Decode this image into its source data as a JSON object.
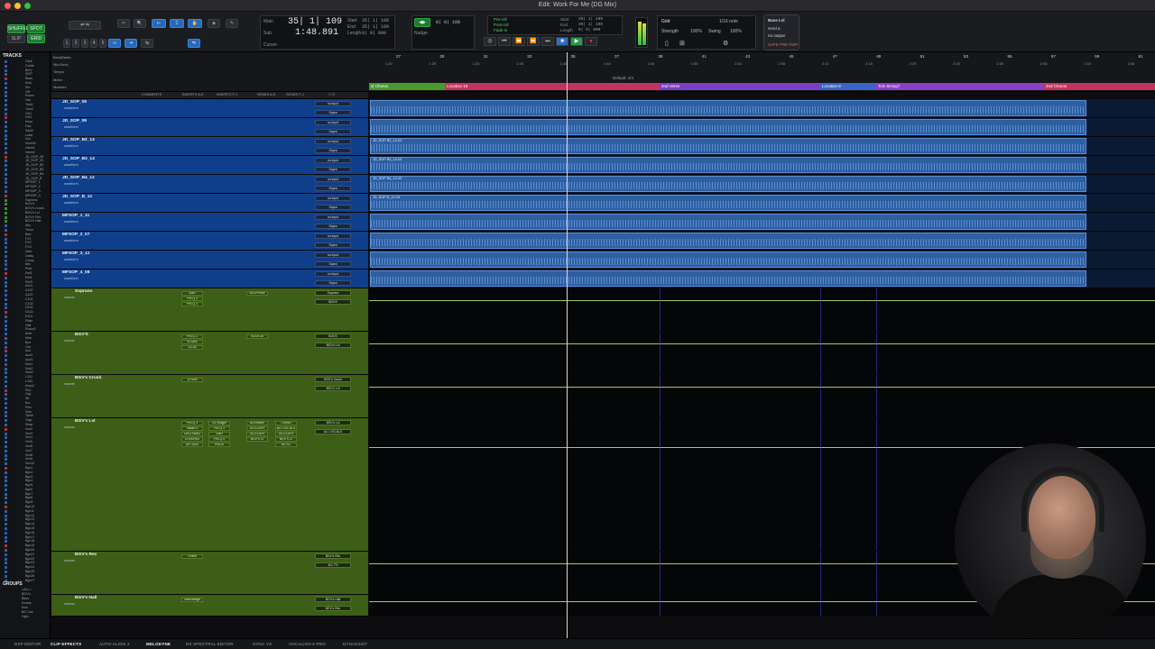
{
  "window": {
    "title": "Edit: Work For Me (DG Mix)"
  },
  "toolbar": {
    "mode_shuffle": "SHUFFLE",
    "mode_spot": "SPOT",
    "mode_slip": "SLIP",
    "mode_grid": "GRID",
    "zoom_presets": [
      "1",
      "2",
      "3",
      "4",
      "5"
    ],
    "counter": {
      "main_label": "Main",
      "sub_label": "Sub",
      "cursor_label": "Cursor",
      "main": "35| 1| 109",
      "sub": "1:48.891",
      "start_label": "Start",
      "end_label": "End",
      "length_label": "Length",
      "start": "35| 1| 109",
      "end": "35| 1| 109",
      "length": "0| 0| 000"
    },
    "nudge_label": "Nudge",
    "nudge_value": "0| 0| 160",
    "preroll_label": "Pre-roll",
    "postroll_label": "Post-roll",
    "fadein_label": "Fade-in",
    "start2_label": "Start",
    "end2_label": "End",
    "length2_label": "Length",
    "start2": "35| 1| 109",
    "end2": "35| 1| 109",
    "length2": "0| 0| 000",
    "grid": {
      "label": "Grid",
      "value": "1/16 note",
      "strength_label": "Strength",
      "strength": "100%",
      "swing_label": "Swing",
      "swing": "100%"
    },
    "right_panel": {
      "line1": "Bass Lvl",
      "line2": "send a",
      "line3": "no output",
      "line4": "SAFE PRE FMP"
    }
  },
  "left": {
    "tracks_header": "TRACKS",
    "tracks": [
      "Click",
      "Guide",
      "BGV",
      "SOP",
      "Bass",
      "Kick",
      "Snr",
      "OH",
      "Room",
      "Hat",
      "Tom1",
      "Tom2",
      "Gtr1",
      "Gtr2",
      "Keys",
      "Pad",
      "Synth",
      "Lead",
      "Vox",
      "VoxDbl",
      "Harm1",
      "Harm2",
      "JD_SOP_08",
      "JD_SOP_09",
      "JD_SOP_B2",
      "JD_SOP_B3",
      "JD_SOP_B4",
      "JD_SOP_B",
      "MFSOP_1",
      "MFSOP_2",
      "MFSOP_3",
      "MFSOP_4",
      "Soprano",
      "BGV's",
      "BGV's Crush",
      "BGV's Lvl",
      "BGV's Rev",
      "BGV's Hall",
      "Alto",
      "Tenor",
      "Bari",
      "FX1",
      "FX2",
      "FX3",
      "Verb",
      "Delay",
      "Comp",
      "Mix",
      "Print",
      "Ref1",
      "Ref2",
      "Ref3",
      "A101",
      "A102",
      "A103",
      "C101",
      "C102",
      "D101",
      "D102",
      "E101",
      "Plate",
      "Hall",
      "Room2",
      "Amb",
      "Mstr",
      "Bus",
      "Out",
      "Aux",
      "Aux2",
      "Aux3",
      "Sub1",
      "Sub2",
      "Sub3",
      "L101",
      "L102",
      "Keys2",
      "Pno",
      "Org",
      "Str",
      "Brs",
      "Perc",
      "Shkr",
      "Tamb",
      "Clap",
      "Snap",
      "Vox2",
      "Vox3",
      "Vox4",
      "Vox5",
      "Vox6",
      "Vox7",
      "Vox8",
      "Vox9",
      "Vox10",
      "Bgv1",
      "Bgv2",
      "Bgv3",
      "Bgv4",
      "Bgv5",
      "Bgv6",
      "Bgv7",
      "Bgv8",
      "Bgv9",
      "Bgv10",
      "Bgv11",
      "Bgv12",
      "Bgv13",
      "Bgv14",
      "Bgv15",
      "Bgv16",
      "Bgv17",
      "Bgv18",
      "Bgv19",
      "Bgv20",
      "Bgv21",
      "Bgv22",
      "Bgv23",
      "Bgv24",
      "Bgv25",
      "Bgv26",
      "Bgv27"
    ],
    "groups_header": "GROUPS",
    "groups": [
      "<ALL>",
      "BGV's",
      "Bass",
      "Drums",
      "Kick",
      "BG Call",
      "Hghl"
    ]
  },
  "ruler": {
    "names": [
      "Bars|Beats",
      "Min:Secs",
      "Tempo",
      "Meter",
      "Markers"
    ],
    "bars": [
      "27",
      "29",
      "31",
      "33",
      "35",
      "37",
      "39",
      "41",
      "43",
      "45",
      "47",
      "49",
      "51",
      "53",
      "55",
      "57",
      "59",
      "61"
    ],
    "mins": [
      "1:20",
      "1:25",
      "1:30",
      "1:35",
      "1:40",
      "1:45",
      "1:50",
      "1:55",
      "2:00",
      "2:05",
      "2:10",
      "2:15",
      "2:20",
      "2:25",
      "2:30",
      "2:35",
      "2:40",
      "2:45"
    ],
    "meter": "Default: 4/4",
    "markers": [
      {
        "label": "st Chorus",
        "color": "#4a9a2e"
      },
      {
        "label": "Location 18",
        "color": "#c2345c"
      },
      {
        "label": "2nd Verse",
        "color": "#7b3fc2"
      },
      {
        "label": "Location 8",
        "color": "#3b64c7"
      },
      {
        "label": "Tom timing?",
        "color": "#8b3fc2"
      },
      {
        "label": "2nd Chorus",
        "color": "#c2345c"
      }
    ]
  },
  "columns": [
    "COMMENTS",
    "INSERTS A-E",
    "INSERTS F-J",
    "SENDS A-E",
    "SENDS F-J",
    "I / O"
  ],
  "tracks": [
    {
      "name": "JD_SOP_08",
      "kind": "audio",
      "mode": "waveform",
      "io1": "no input",
      "io2": "Sopra"
    },
    {
      "name": "JD_SOP_09",
      "kind": "audio",
      "mode": "waveform",
      "io1": "no input",
      "io2": "Sopra"
    },
    {
      "name": "JD_SOP_B2_14",
      "kind": "audio",
      "mode": "waveform",
      "io1": "no input",
      "io2": "Sopra",
      "clip": "JD_SOP B2_14-03"
    },
    {
      "name": "JD_SOP_B3_14",
      "kind": "audio",
      "mode": "waveform",
      "io1": "no input",
      "io2": "Sopra",
      "clip": "JD_SOP B3_14-03"
    },
    {
      "name": "JD_SOP_B4_12",
      "kind": "audio",
      "mode": "waveform",
      "io1": "no input",
      "io2": "Sopra",
      "clip": "JD_SOP B4_12-03"
    },
    {
      "name": "JD_SOP_B_12",
      "kind": "audio",
      "mode": "waveform",
      "io1": "no input",
      "io2": "Sopra",
      "clip": "JD_SOP B_12-03"
    },
    {
      "name": "MFSOP_1_11",
      "kind": "audio",
      "mode": "waveform",
      "io1": "no input",
      "io2": "Sopra"
    },
    {
      "name": "MFSOP_2_07",
      "kind": "audio",
      "mode": "waveform",
      "io1": "no input",
      "io2": "Sopra"
    },
    {
      "name": "MFSOP_3_12",
      "kind": "audio",
      "mode": "waveform",
      "io1": "no input",
      "io2": "Sopra"
    },
    {
      "name": "MFSOP_4_08",
      "kind": "audio",
      "mode": "waveform",
      "io1": "no input",
      "io2": "Sopra"
    },
    {
      "name": "Soprano",
      "kind": "aux",
      "mode": "volume",
      "io1": "Soprano",
      "io2": "BGVS",
      "inserts": [
        "VMR",
        "Pro-Q 3",
        "Pro-Q 3"
      ],
      "sends": [
        "BGV/Proce"
      ]
    },
    {
      "name": "BGV'S",
      "kind": "aux",
      "mode": "volume",
      "io1": "BGVS",
      "io2": "BGV's Lvl",
      "inserts": [
        "Pro-Q 3",
        "1176AE",
        "LA-3A"
      ],
      "sends": [
        "BGV/Cru"
      ]
    },
    {
      "name": "BGV's Crush",
      "kind": "aux",
      "mode": "volume",
      "io1": "BGV's Crush",
      "io2": "BGV's Lvl",
      "inserts": [
        "1176AE"
      ],
      "sends": []
    },
    {
      "name": "BGV's Lvl",
      "kind": "aux",
      "mode": "volume",
      "io1": "BGV's Lvl",
      "io2": "ALL VOCALS",
      "inserts": [
        "Pro-Q 3",
        "Saturn 2",
        "ChSTRMK3",
        "CH3SPIK3",
        "API 2500"
      ],
      "sends": [
        "BGVMaxH",
        "DS-ELAPS",
        "DS-ELAPS",
        "BGV'S Cl"
      ],
      "inserts2": [
        "D1 Imager",
        "Pro-Q 3",
        "VMR",
        "Pro-Q 4",
        "ProDS"
      ],
      "sends2": [
        "Church",
        "ALL VOCALS",
        "DS-ELAPS",
        "BGV'S Cl",
        "BG SC"
      ]
    },
    {
      "name": "BGV's Rev",
      "kind": "aux",
      "mode": "volume",
      "io1": "BGV's Rev",
      "io2": "ALL FX",
      "inserts": [
        "RVerb"
      ],
      "sends": []
    },
    {
      "name": "BGV's Hall",
      "kind": "aux",
      "mode": "volume",
      "io1": "BGV's Hall",
      "io2": "BGV's Rev",
      "inserts": [
        "ValhVintage"
      ],
      "sends": []
    }
  ],
  "bottombar": [
    "DSP EDITOR",
    "CLIP EFFECTS",
    "AUTO-ALIGN 2",
    "MELODYNE",
    "RX SPECTRAL EDITOR",
    "SYNC VX",
    "VOCALIGN 6 PRO",
    "DYNASSIST"
  ],
  "bottom_active": [
    "CLIP EFFECTS",
    "MELODYNE"
  ],
  "colors": {
    "audio_track": "#0f3f8a",
    "aux_track": "#3c5e16",
    "clip": "#2e5fa0",
    "automation": "#a4c86a"
  }
}
